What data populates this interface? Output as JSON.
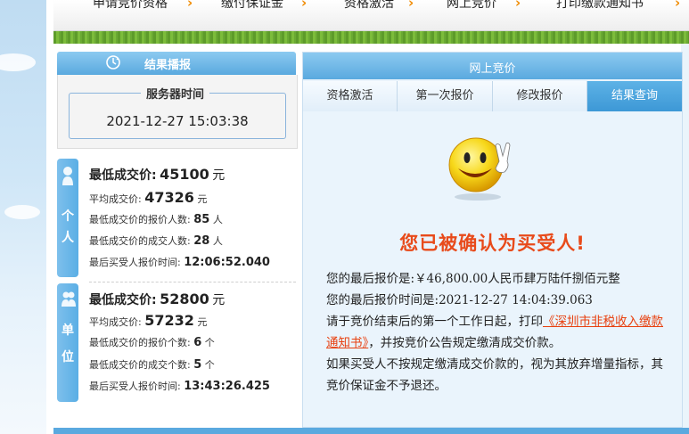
{
  "top_nav": {
    "items": [
      {
        "label": "申请竞价资格"
      },
      {
        "label": "缴付保证金"
      },
      {
        "label": "资格激活"
      },
      {
        "label": "网上竞价"
      },
      {
        "label": "打印缴款通知书"
      }
    ]
  },
  "left_panel": {
    "title": "结果播报",
    "server_time_label": "服务器时间",
    "server_time": "2021-12-27 15:03:38",
    "groups": [
      {
        "tag": "个人",
        "min_price_label": "最低成交价:",
        "min_price": "45100",
        "min_price_unit": "元",
        "avg_price_label": "平均成交价:",
        "avg_price": "47326",
        "avg_price_unit": "元",
        "bidders_label": "最低成交价的报价人数:",
        "bidders": "85",
        "bidders_unit": "人",
        "deals_label": "最低成交价的成交人数:",
        "deals": "28",
        "deals_unit": "人",
        "last_time_label": "最后买受人报价时间:",
        "last_time": "12:06:52.040"
      },
      {
        "tag": "单位",
        "min_price_label": "最低成交价:",
        "min_price": "52800",
        "min_price_unit": "元",
        "avg_price_label": "平均成交价:",
        "avg_price": "57232",
        "avg_price_unit": "元",
        "bidders_label": "最低成交价的报价个数:",
        "bidders": "6",
        "bidders_unit": "个",
        "deals_label": "最低成交价的成交个数:",
        "deals": "5",
        "deals_unit": "个",
        "last_time_label": "最后买受人报价时间:",
        "last_time": "13:43:26.425"
      }
    ]
  },
  "right_panel": {
    "title": "网上竞价",
    "tabs": [
      {
        "label": "资格激活",
        "active": false
      },
      {
        "label": "第一次报价",
        "active": false
      },
      {
        "label": "修改报价",
        "active": false
      },
      {
        "label": "结果查询",
        "active": true
      }
    ],
    "success_message": "您已被确认为买受人!",
    "final_price_label": "您的最后报价是:",
    "final_price": "￥46,800.00人民币肆万陆仟捌佰元整",
    "final_time_label": "您的最后报价时间是:",
    "final_time": "2021-12-27 14:04:39.063",
    "instruction_prefix": "请于竞价结束后的第一个工作日起，打印",
    "instruction_link": "《深圳市非税收入缴款通知书》",
    "instruction_suffix": "，并按竞价公告规定缴清成交价款。",
    "warning": "如果买受人不按规定缴清成交价款的，视为其放弃增量指标，其竞价保证金不予退还。"
  },
  "colors": {
    "accent_blue": "#5aa9df",
    "success_red": "#e84a1a",
    "nav_arrow": "#f08a00"
  },
  "icons": [
    "refresh-icon",
    "person-icon",
    "group-icon",
    "smiley-victory-icon",
    "chevron-right-icon"
  ]
}
